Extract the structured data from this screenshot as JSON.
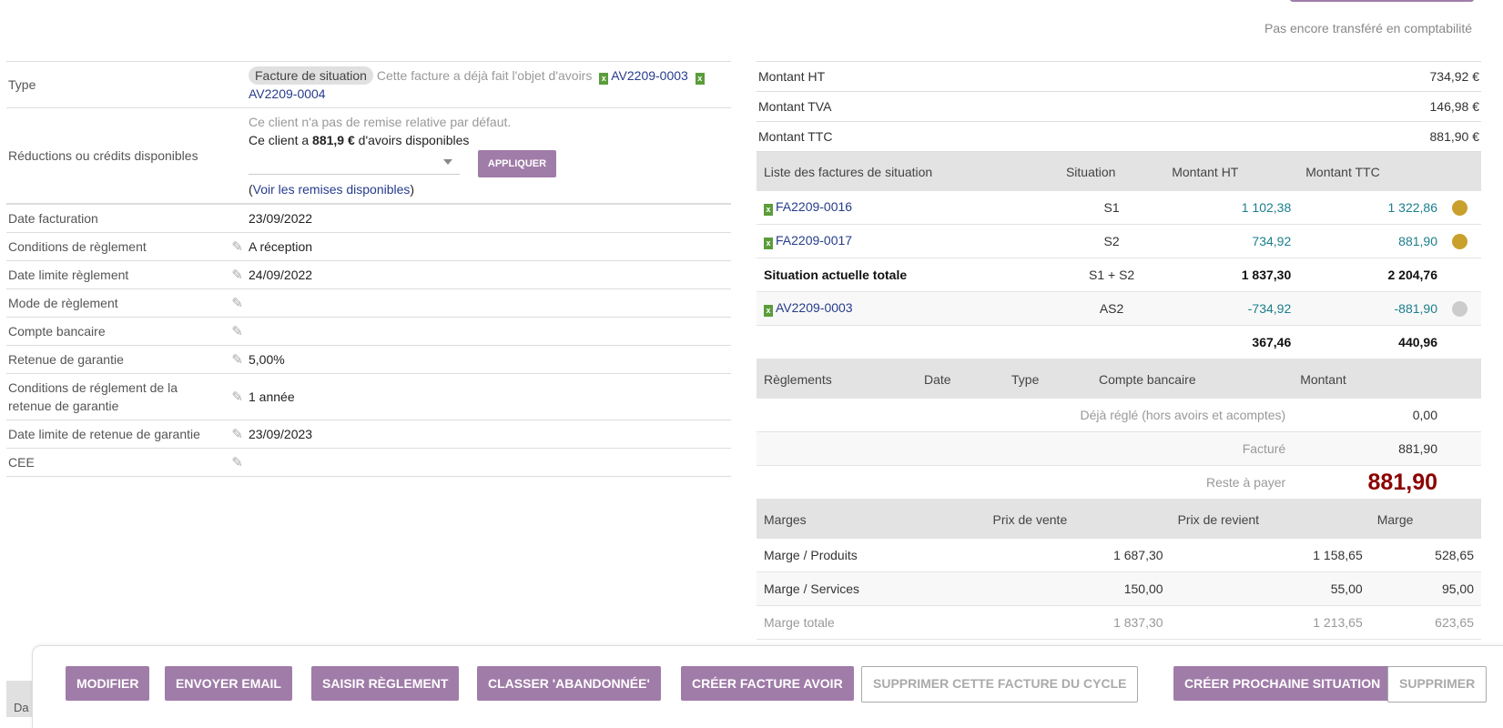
{
  "header": {
    "accounting_status": "Pas encore transféré en comptabilité"
  },
  "fields": {
    "type": {
      "label": "Type",
      "badge": "Facture de situation",
      "note": "Cette facture a déjà fait l'objet d'avoirs",
      "links": [
        "AV2209-0003",
        "AV2209-0004"
      ]
    },
    "discounts": {
      "label": "Réductions ou crédits disponibles",
      "line1": "Ce client n'a pas de remise relative par défaut.",
      "line2_prefix": "Ce client a",
      "line2_amount": "881,9 €",
      "line2_suffix": "d'avoirs disponibles",
      "apply_label": "APPLIQUER",
      "open_paren": "(",
      "see_link": "Voir les remises disponibles",
      "close_paren": ")"
    },
    "rows": [
      {
        "label": "Date facturation",
        "value": "23/09/2022",
        "editable": false
      },
      {
        "label": "Conditions de règlement",
        "value": "A réception",
        "editable": true
      },
      {
        "label": "Date limite règlement",
        "value": "24/09/2022",
        "editable": true
      },
      {
        "label": "Mode de règlement",
        "value": "",
        "editable": true
      },
      {
        "label": "Compte bancaire",
        "value": "",
        "editable": true
      },
      {
        "label": "Retenue de garantie",
        "value": "5,00%",
        "editable": true
      },
      {
        "label": "Conditions de réglement de la retenue de garantie",
        "value": "1 année",
        "editable": true
      },
      {
        "label": "Date limite de retenue de garantie",
        "value": "23/09/2023",
        "editable": true
      },
      {
        "label": "CEE",
        "value": "",
        "editable": true
      }
    ]
  },
  "amounts": [
    {
      "label": "Montant HT",
      "value": "734,92 €"
    },
    {
      "label": "Montant TVA",
      "value": "146,98 €"
    },
    {
      "label": "Montant TTC",
      "value": "881,90 €"
    }
  ],
  "situations": {
    "headers": [
      "Liste des factures de situation",
      "Situation",
      "Montant HT",
      "Montant TTC"
    ],
    "rows": [
      {
        "ref": "FA2209-0016",
        "situation": "S1",
        "ht": "1 102,38",
        "ttc": "1 322,86",
        "status_color": "#c9a02b"
      },
      {
        "ref": "FA2209-0017",
        "situation": "S2",
        "ht": "734,92",
        "ttc": "881,90",
        "status_color": "#c9a02b"
      }
    ],
    "total": {
      "label": "Situation actuelle totale",
      "situation": "S1 + S2",
      "ht": "1 837,30",
      "ttc": "2 204,76"
    },
    "credit": {
      "ref": "AV2209-0003",
      "situation": "AS2",
      "ht": "-734,92",
      "ttc": "-881,90",
      "status_color": "#cccccc"
    },
    "remaining": {
      "ht": "367,46",
      "ttc": "440,96"
    }
  },
  "payments": {
    "headers": [
      "Règlements",
      "Date",
      "Type",
      "Compte bancaire",
      "Montant"
    ],
    "already_paid_label": "Déjà réglé (hors avoirs et acomptes)",
    "already_paid": "0,00",
    "invoiced_label": "Facturé",
    "invoiced": "881,90",
    "remaining_label": "Reste à payer",
    "remaining": "881,90"
  },
  "margins": {
    "headers": [
      "Marges",
      "Prix de vente",
      "Prix de revient",
      "Marge"
    ],
    "rows": [
      {
        "label": "Marge / Produits",
        "sale": "1 687,30",
        "cost": "1 158,65",
        "margin": "528,65"
      },
      {
        "label": "Marge / Services",
        "sale": "150,00",
        "cost": "55,00",
        "margin": "95,00"
      }
    ],
    "total": {
      "label": "Marge totale",
      "sale": "1 837,30",
      "cost": "1 213,65",
      "margin": "623,65"
    }
  },
  "actions": {
    "modify": "MODIFIER",
    "send_email": "ENVOYER EMAIL",
    "enter_payment": "SAISIR RÈGLEMENT",
    "classify_abandoned": "CLASSER 'ABANDONNÉE'",
    "create_credit_note": "CRÉER FACTURE AVOIR",
    "remove_from_cycle": "SUPPRIMER CETTE FACTURE DU CYCLE",
    "create_next_situation": "CRÉER PROCHAINE SITUATION",
    "delete": "SUPPRIMER"
  },
  "peek_text": "Da",
  "icons": {
    "edit": "pencil-icon",
    "file": "spreadsheet-file-icon"
  },
  "colors": {
    "accent": "#a07ca8",
    "link": "#263c8c",
    "amount": "#1b7e8c",
    "due": "#8b0000"
  }
}
